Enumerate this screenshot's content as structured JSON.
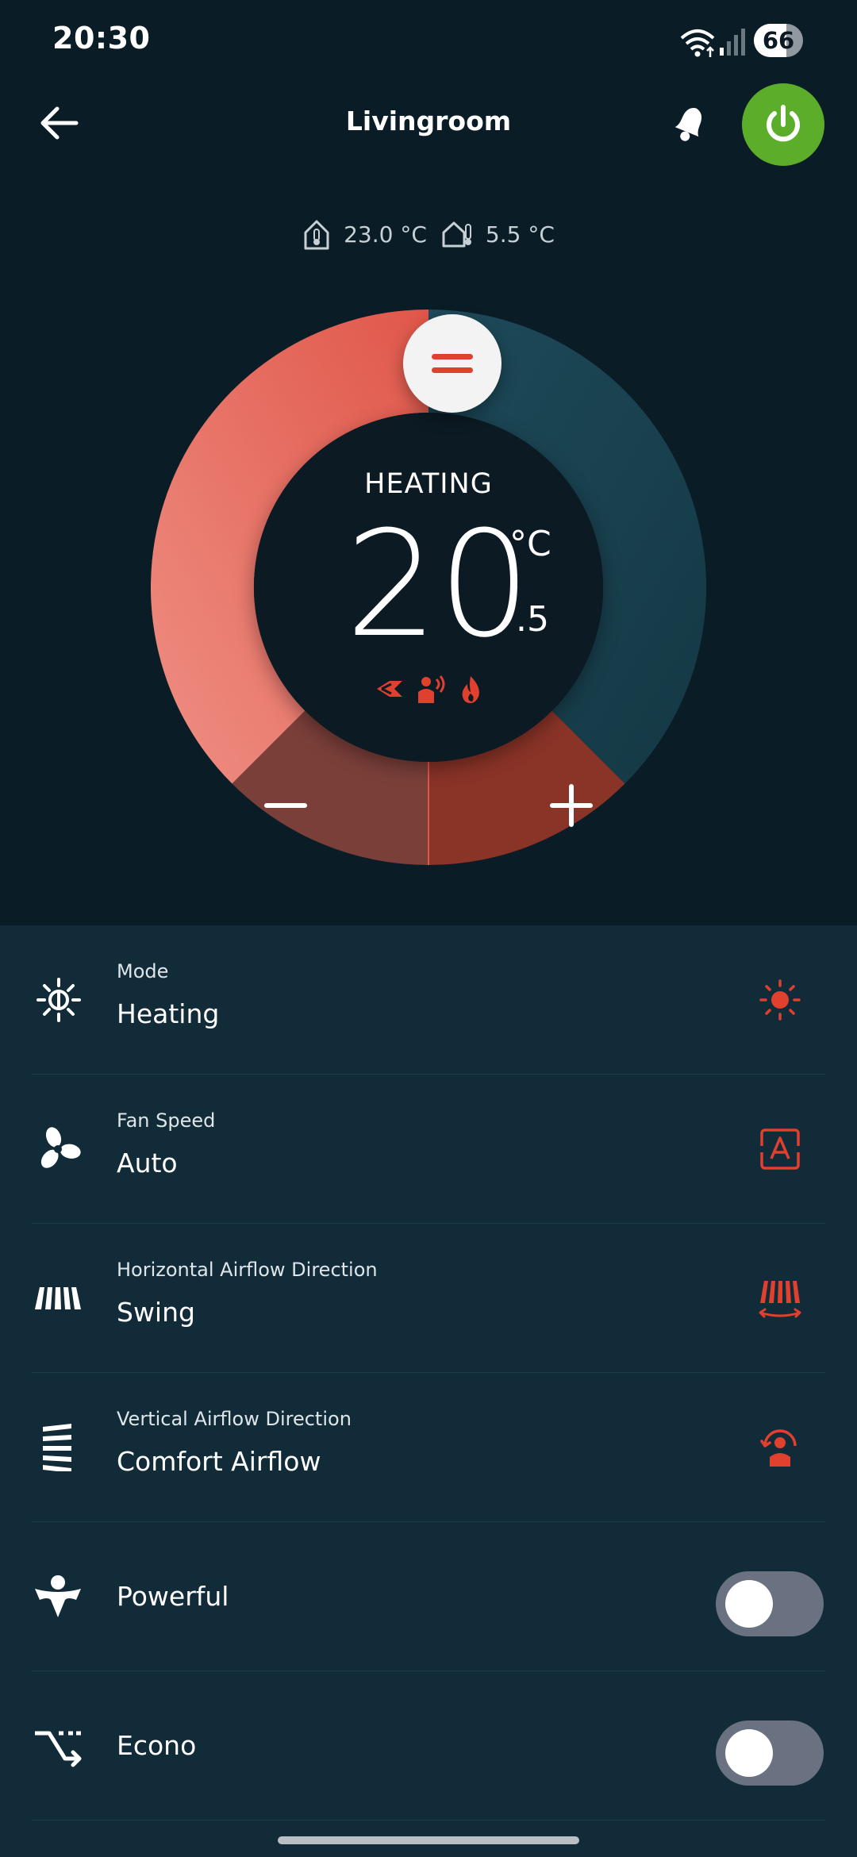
{
  "status_bar": {
    "time": "20:30",
    "battery": "66",
    "battery_level": 0.66
  },
  "header": {
    "title": "Livingroom"
  },
  "temperatures": {
    "indoor": "23.0 °C",
    "outdoor": "5.5 °C"
  },
  "thermostat": {
    "mode": "HEATING",
    "setpoint_int": "20",
    "setpoint_dec": ".5",
    "unit": "°C",
    "minus": "−",
    "plus": "+"
  },
  "settings": [
    {
      "label": "Mode",
      "value": "Heating"
    },
    {
      "label": "Fan Speed",
      "value": "Auto"
    },
    {
      "label": "Horizontal Airflow Direction",
      "value": "Swing"
    },
    {
      "label": "Vertical Airflow Direction",
      "value": "Comfort Airflow"
    }
  ],
  "toggles": [
    {
      "label": "Powerful",
      "on": false
    },
    {
      "label": "Econo",
      "on": false
    }
  ],
  "colors": {
    "accent": "#e0402e",
    "power": "#5cad2a",
    "background": "#0a1c26",
    "panel": "#112b38"
  }
}
